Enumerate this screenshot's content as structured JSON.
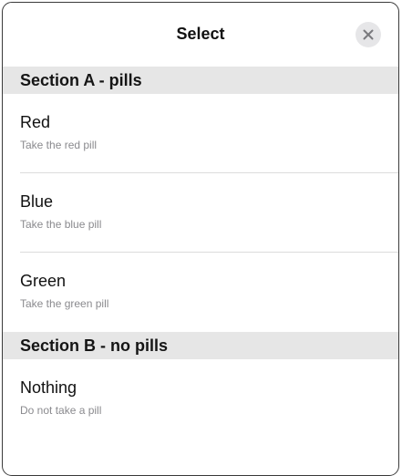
{
  "dialog": {
    "title": "Select",
    "close_icon": "close-icon"
  },
  "sections": [
    {
      "title": "Section A - pills",
      "items": [
        {
          "label": "Red",
          "description": "Take the red pill"
        },
        {
          "label": "Blue",
          "description": "Take the blue pill"
        },
        {
          "label": "Green",
          "description": "Take the green pill"
        }
      ]
    },
    {
      "title": "Section B - no pills",
      "items": [
        {
          "label": "Nothing",
          "description": "Do not take a pill"
        }
      ]
    }
  ],
  "colors": {
    "section_background": "#e6e6e6",
    "description_text": "#8a8a8e",
    "close_button_background": "#e6e6e8"
  }
}
